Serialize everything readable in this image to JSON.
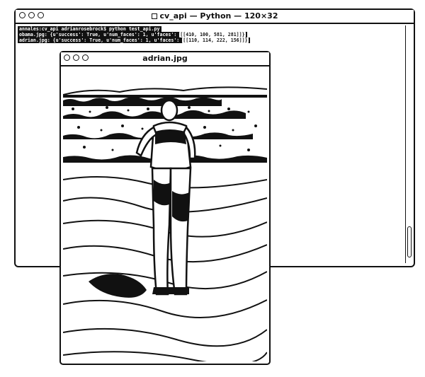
{
  "terminal": {
    "title": "cv_api — Python — 120×32",
    "lines": [
      {
        "prompt": "annales:cv_api adrianrosebrock$ python test_api.py",
        "highlight": ""
      },
      {
        "prompt": "obama.jpg: {u'success': True, u'num_faces': 1, u'faces': ",
        "highlight": "[[410, 100, 581, 281]]}"
      },
      {
        "prompt": "adrian.jpg: {u'success': True, u'num_faces': 1, u'faces': ",
        "highlight": "[[110, 114, 222, 156]]}"
      }
    ]
  },
  "viewer": {
    "title": "adrian.jpg",
    "image_description_icon": "photo-person-standing-on-rocks"
  },
  "colors": {
    "ink": "#111111",
    "paper": "#ffffff"
  }
}
